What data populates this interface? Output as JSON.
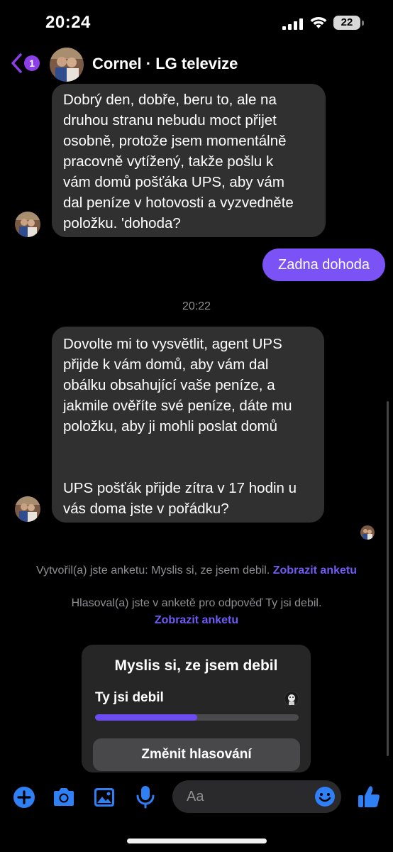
{
  "status_bar": {
    "time": "20:24",
    "battery": "22"
  },
  "header": {
    "back_count": "1",
    "contact_name": "Cornel · LG televize"
  },
  "messages": {
    "incoming_1": "Dobrý den, dobře, beru to, ale na\ndruhou stranu nebudu moct přijet\nosobně, protože jsem momentálně\npracovně vytížený, takže pošlu k\nvám domů pošťáka UPS, aby vám\ndal peníze v hotovosti a vyzvedněte\npoložku. 'dohoda?",
    "outgoing_1": "Zadna dohoda",
    "timestamp": "20:22",
    "incoming_2": "Dovolte mi to vysvětlit, agent UPS\npřijde k vám domů, aby vám dal\nobálku obsahující vaše peníze, a\njakmile ověříte své peníze, dáte mu\npoložku, aby ji mohli poslat domů\n\n\nUPS pošťák přijde zítra v 17 hodin u\nvás doma jste v pořádku?"
  },
  "system": {
    "poll_created": "Vytvořil(a) jste anketu: Myslis si, ze jsem debil.",
    "poll_created_link": "Zobrazit anketu",
    "poll_voted": "Hlasoval(a) jste v anketě pro odpověď Ty jsi debil.",
    "poll_voted_link": "Zobrazit anketu"
  },
  "poll": {
    "question": "Myslis si, ze jsem debil",
    "option": "Ty jsi debil",
    "option_fill_fraction": 0.5,
    "change_vote_label": "Změnit hlasování"
  },
  "composer": {
    "placeholder": "Aa",
    "icons": [
      "plus-icon",
      "camera-icon",
      "image-icon",
      "microphone-icon",
      "emoji-icon",
      "thumbs-up-icon"
    ]
  },
  "colors": {
    "accent": "#7b52f5",
    "link": "#6f5bf6",
    "bubble_incoming": "#303030",
    "icon_blue": "#2f7ff5"
  }
}
